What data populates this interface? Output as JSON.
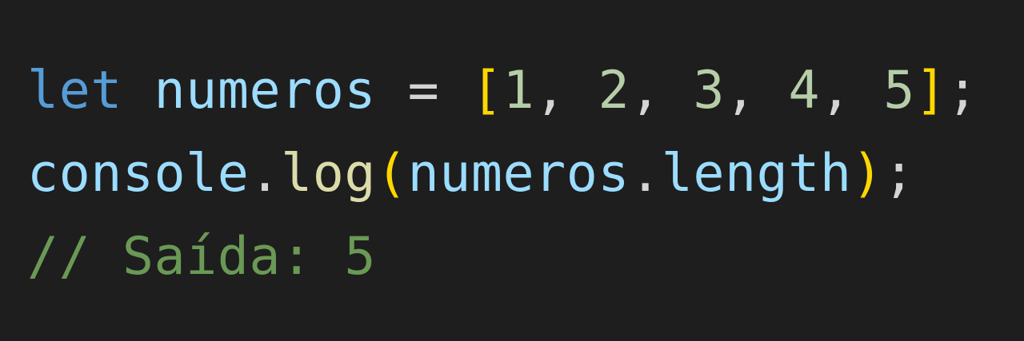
{
  "editor": {
    "theme_colors": {
      "background": "#1e1e1e",
      "keyword": "#569cd6",
      "variable": "#9cdcfe",
      "number": "#b5cea8",
      "bracket": "#ffd700",
      "paren": "#da70d6",
      "function": "#dcdcaa",
      "comment": "#6a9955",
      "punctuation": "#d4d4d4"
    },
    "lines": [
      {
        "tokens": {
          "keyword": "let",
          "space1": " ",
          "identifier": "numeros",
          "space2": " ",
          "operator": "=",
          "space3": " ",
          "open_bracket": "[",
          "n1": "1",
          "c1": ", ",
          "n2": "2",
          "c2": ", ",
          "n3": "3",
          "c3": ", ",
          "n4": "4",
          "c4": ", ",
          "n5": "5",
          "close_bracket": "]",
          "semicolon": ";"
        }
      },
      {
        "tokens": {
          "object": "console",
          "dot1": ".",
          "method": "log",
          "open_paren": "(",
          "arg_object": "numeros",
          "dot2": ".",
          "arg_property": "length",
          "close_paren": ")",
          "semicolon": ";"
        }
      },
      {
        "tokens": {
          "comment": "// Saída: 5"
        }
      }
    ]
  }
}
